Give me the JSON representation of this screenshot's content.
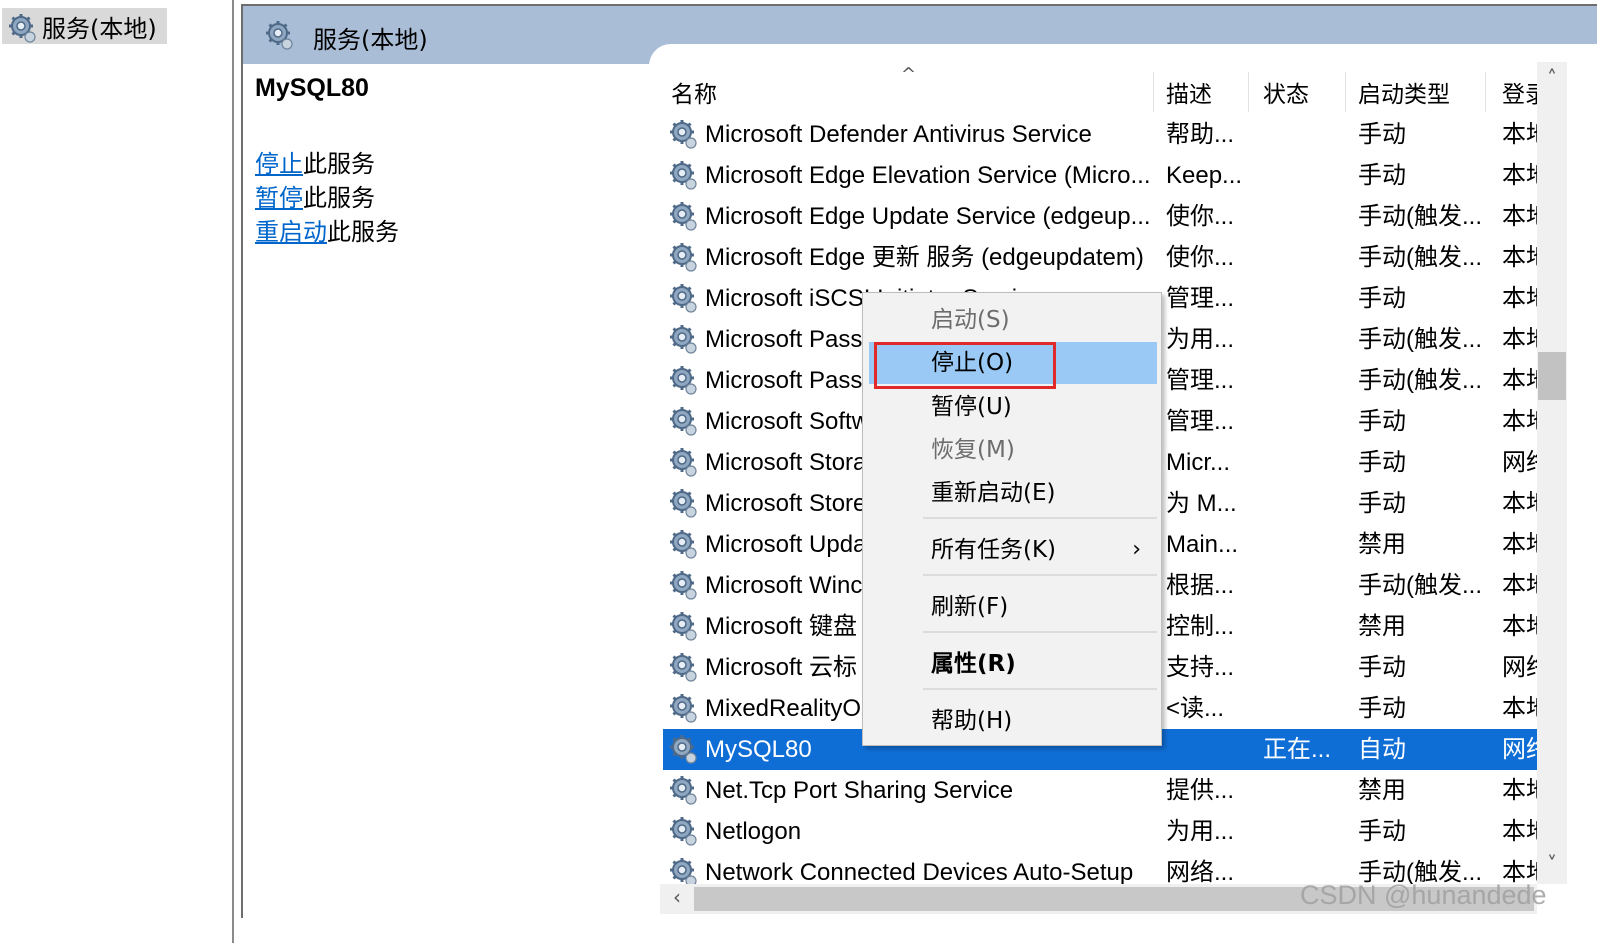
{
  "tree": {
    "root_label": "服务(本地)"
  },
  "header": {
    "title": "服务(本地)"
  },
  "details": {
    "service_name": "MySQL80",
    "actions": [
      {
        "link": "停止",
        "suffix": "此服务"
      },
      {
        "link": "暂停",
        "suffix": "此服务"
      },
      {
        "link": "重启动",
        "suffix": "此服务"
      }
    ]
  },
  "columns": {
    "name": "名称",
    "description": "描述",
    "status": "状态",
    "startup": "启动类型",
    "logon": "登录"
  },
  "rows": [
    {
      "name": "Microsoft Defender Antivirus Service",
      "desc": "帮助...",
      "status": "",
      "startup": "手动",
      "logon": "本地"
    },
    {
      "name": "Microsoft Edge Elevation Service (Micro...",
      "desc": "Keep...",
      "status": "",
      "startup": "手动",
      "logon": "本地"
    },
    {
      "name": "Microsoft Edge Update Service (edgeup...",
      "desc": "使你...",
      "status": "",
      "startup": "手动(触发...",
      "logon": "本地"
    },
    {
      "name": "Microsoft Edge 更新 服务 (edgeupdatem)",
      "desc": "使你...",
      "status": "",
      "startup": "手动(触发...",
      "logon": "本地"
    },
    {
      "name": "Microsoft iSCSI Initiator Service",
      "desc": "管理...",
      "status": "",
      "startup": "手动",
      "logon": "本地"
    },
    {
      "name": "Microsoft Passp",
      "desc": "为用...",
      "status": "",
      "startup": "手动(触发...",
      "logon": "本地"
    },
    {
      "name": "Microsoft Passp",
      "desc": "管理...",
      "status": "",
      "startup": "手动(触发...",
      "logon": "本地"
    },
    {
      "name": "Microsoft Softw",
      "desc": "管理...",
      "status": "",
      "startup": "手动",
      "logon": "本地"
    },
    {
      "name": "Microsoft Stora",
      "desc": "Micr...",
      "status": "",
      "startup": "手动",
      "logon": "网络"
    },
    {
      "name": "Microsoft Store",
      "desc": "为 M...",
      "status": "",
      "startup": "手动",
      "logon": "本地"
    },
    {
      "name": "Microsoft Upda",
      "desc": "Main...",
      "status": "",
      "startup": "禁用",
      "logon": "本地"
    },
    {
      "name": "Microsoft Winc",
      "desc": "根据...",
      "status": "",
      "startup": "手动(触发...",
      "logon": "本地"
    },
    {
      "name": "Microsoft 键盘",
      "desc": "控制...",
      "status": "",
      "startup": "禁用",
      "logon": "本地"
    },
    {
      "name": "Microsoft 云标",
      "desc": "支持...",
      "status": "",
      "startup": "手动",
      "logon": "网络"
    },
    {
      "name": "MixedRealityO",
      "desc": "<读...",
      "status": "",
      "startup": "手动",
      "logon": "本地"
    },
    {
      "name": "MySQL80",
      "desc": "",
      "status": "正在...",
      "startup": "自动",
      "logon": "网络",
      "selected": true
    },
    {
      "name": "Net.Tcp Port Sharing Service",
      "desc": "提供...",
      "status": "",
      "startup": "禁用",
      "logon": "本地"
    },
    {
      "name": "Netlogon",
      "desc": "为用...",
      "status": "",
      "startup": "手动",
      "logon": "本地"
    },
    {
      "name": "Network Connected Devices Auto-Setup",
      "desc": "网络...",
      "status": "",
      "startup": "手动(触发...",
      "logon": "本地"
    }
  ],
  "context_menu": {
    "start": "启动(S)",
    "stop": "停止(O)",
    "pause": "暂停(U)",
    "resume": "恢复(M)",
    "restart": "重新启动(E)",
    "all_tasks": "所有任务(K)",
    "refresh": "刷新(F)",
    "properties": "属性(R)",
    "help": "帮助(H)",
    "submenu_arrow": "›"
  },
  "watermark": "CSDN @hunandede",
  "colors": {
    "header_bar": "#a9bdd6",
    "selection": "#0f6ed6",
    "menu_highlight": "#99c9f4",
    "link": "#0066cc",
    "annotation_box": "#e02a2a"
  },
  "icons": {
    "service": "gear-icon"
  }
}
